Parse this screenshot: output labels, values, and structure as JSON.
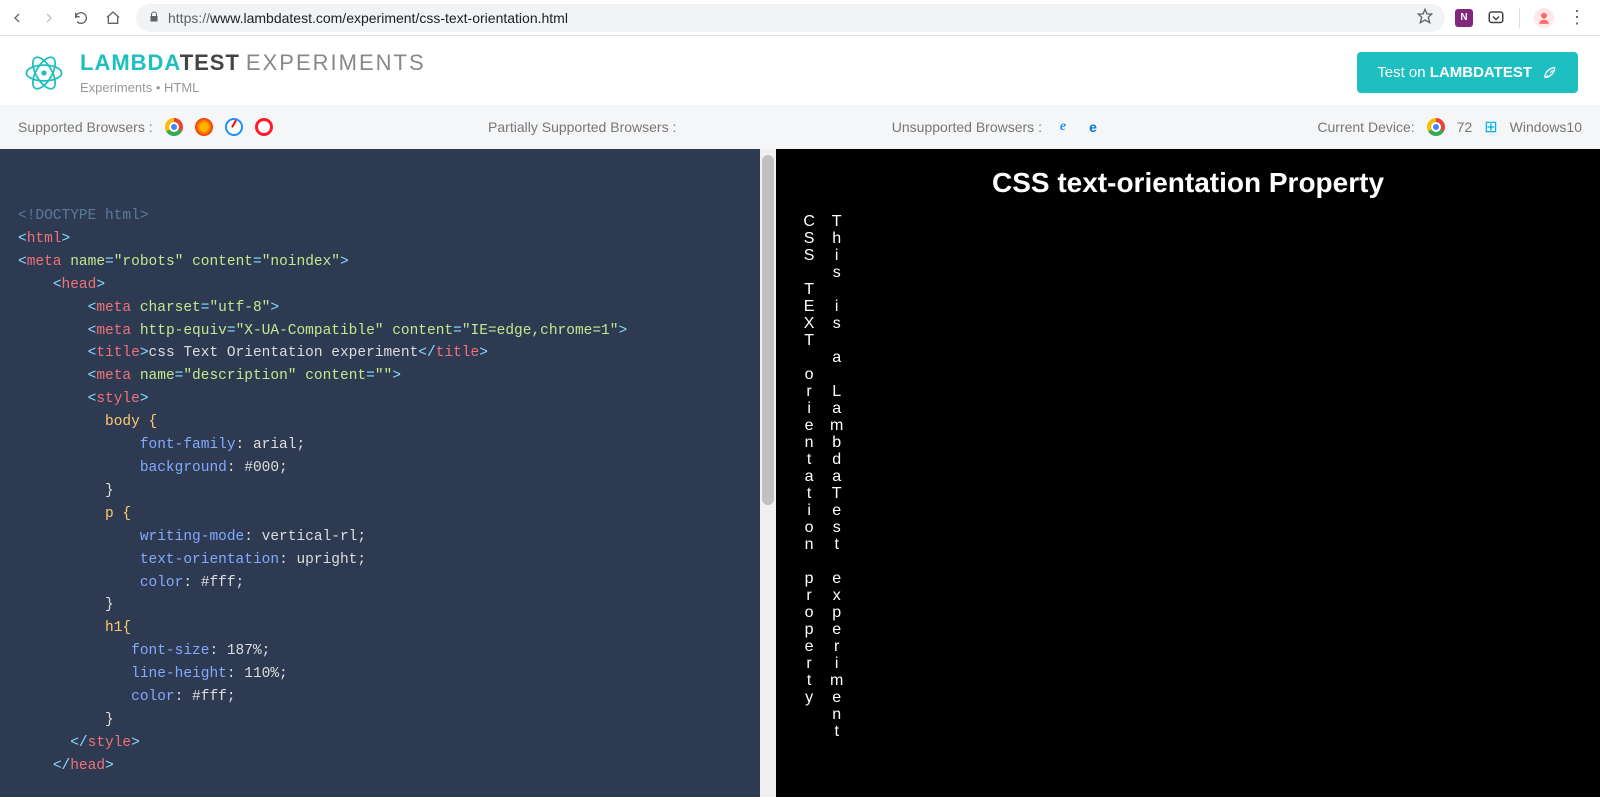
{
  "browser": {
    "url_proto": "https://",
    "url_rest": "www.lambdatest.com/experiment/css-text-orientation.html"
  },
  "header": {
    "logo_lambda": "LAMBDA",
    "logo_test": "TEST",
    "logo_exp": "EXPERIMENTS",
    "subtitle": "Experiments • HTML",
    "cta_prefix": "Test on ",
    "cta_strong": "LAMBDATEST"
  },
  "strip": {
    "supported_label": "Supported Browsers :",
    "partial_label": "Partially Supported Browsers :",
    "unsupported_label": "Unsupported Browsers :",
    "device_label": "Current Device:",
    "device_version": "72",
    "device_os": "Windows10"
  },
  "code": {
    "l1": "<!DOCTYPE html>",
    "l2_open": "<",
    "l2_tag": "html",
    "l2_close": ">",
    "l3_open": "<",
    "l3_tag": "meta",
    "l3_a1": "name",
    "l3_v1": "\"robots\"",
    "l3_a2": "content",
    "l3_v2": "\"noindex\"",
    "l3_close": ">",
    "l4": "head",
    "l5_tag": "meta",
    "l5_a": "charset",
    "l5_v": "\"utf-8\"",
    "l6_tag": "meta",
    "l6_a1": "http-equiv",
    "l6_v1": "\"X-UA-Compatible\"",
    "l6_a2": "content",
    "l6_v2": "\"IE=edge,chrome=1\"",
    "l7_tag": "title",
    "l7_text": "css Text Orientation experiment",
    "l8_tag": "meta",
    "l8_a1": "name",
    "l8_v1": "\"description\"",
    "l8_a2": "content",
    "l8_v2": "\"\"",
    "l9_tag": "style",
    "css_body_sel": "body {",
    "css_ff_prop": "font-family",
    "css_ff_val": ": arial;",
    "css_bg_prop": "background",
    "css_bg_val": ": #000;",
    "css_close": "}",
    "css_p_sel": "p {",
    "css_wm_prop": "writing-mode",
    "css_wm_val": ": vertical-rl;",
    "css_to_prop": "text-orientation",
    "css_to_val": ": upright;",
    "css_col_prop": "color",
    "css_col_val": ": #fff;",
    "css_h1_sel": "h1{",
    "css_fs_prop": "font-size",
    "css_fs_val": ": 187%;",
    "css_lh_prop": "line-height",
    "css_lh_val": ": 110%;",
    "l_style_close": "style",
    "l_head_close": "head"
  },
  "preview": {
    "heading": "CSS text-orientation Property",
    "p1": "CSS TEXT orientation property",
    "p2": "This is a LambdaTest experiment"
  }
}
